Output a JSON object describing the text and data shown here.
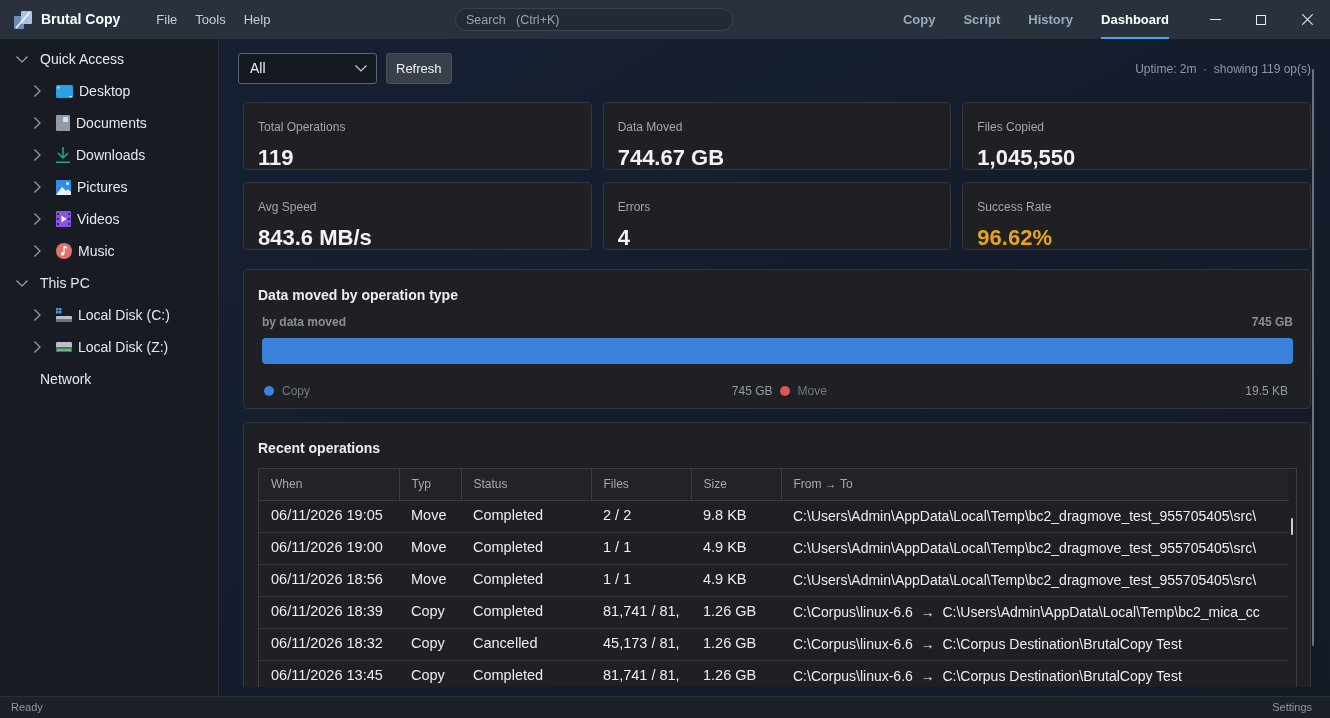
{
  "app": {
    "name": "Brutal Copy"
  },
  "menu": [
    "File",
    "Tools",
    "Help"
  ],
  "search": {
    "placeholder": "Search   (Ctrl+K)"
  },
  "tabs": [
    {
      "label": "Copy",
      "selected": false
    },
    {
      "label": "Script",
      "selected": false
    },
    {
      "label": "History",
      "selected": false
    },
    {
      "label": "Dashboard",
      "selected": true
    }
  ],
  "sidebar": {
    "items": [
      {
        "label": "Quick Access",
        "expanded": true,
        "children": [
          {
            "label": "Desktop",
            "kind": "desktop",
            "expanded": false
          },
          {
            "label": "Documents",
            "kind": "documents",
            "expanded": false
          },
          {
            "label": "Downloads",
            "kind": "downloads",
            "expanded": false
          },
          {
            "label": "Pictures",
            "kind": "pictures",
            "expanded": false
          },
          {
            "label": "Videos",
            "kind": "videos",
            "expanded": false
          },
          {
            "label": "Music",
            "kind": "music",
            "expanded": false
          }
        ]
      },
      {
        "label": "This PC",
        "expanded": true,
        "children": [
          {
            "label": "Local Disk (C:)",
            "kind": "system_drive",
            "expanded": false
          },
          {
            "label": "Local Disk (Z:)",
            "kind": "drive",
            "expanded": false
          }
        ]
      },
      {
        "label": "Network"
      }
    ]
  },
  "toolbar": {
    "filter": {
      "value": "All"
    },
    "refresh_button": "Refresh",
    "uptime": "Uptime: 2m  ·  showing 119 op(s)"
  },
  "stats": [
    {
      "label": "Total Operations",
      "value": "119",
      "color": "#f1f2f4"
    },
    {
      "label": "Data Moved",
      "value": "744.67 GB",
      "color": "#f1f2f4"
    },
    {
      "label": "Files Copied",
      "value": "1,045,550",
      "color": "#f1f2f4"
    },
    {
      "label": "Avg Speed",
      "value": "843.6 MB/s",
      "color": "#f1f2f4"
    },
    {
      "label": "Errors",
      "value": "4",
      "color": "#f1f2f4"
    },
    {
      "label": "Success Rate",
      "value": "96.62%",
      "color": "#e8a317"
    }
  ],
  "breakdown": {
    "title": "Data moved by operation type",
    "subtitle": "by data moved",
    "total": "745 GB",
    "segments": [
      {
        "name": "Copy",
        "color": "#3b82dc",
        "level": 1,
        "reading": "745 GB"
      },
      {
        "name": "Move",
        "color": "#e05555",
        "reading": "19.5 KB"
      }
    ]
  },
  "recent": {
    "title": "Recent operations",
    "table": {
      "columns": [
        "When",
        "Typ",
        "Status",
        "Files",
        "Size",
        "From → To"
      ],
      "rows": [
        [
          "06/11/2026 19:05",
          "Move",
          "Completed",
          "2 / 2",
          "9.8 KB",
          "C:\\Users\\Admin\\AppData\\Local\\Temp\\bc2_dragmove_test_955705405\\src\\"
        ],
        [
          "06/11/2026 19:00",
          "Move",
          "Completed",
          "1 / 1",
          "4.9 KB",
          "C:\\Users\\Admin\\AppData\\Local\\Temp\\bc2_dragmove_test_955705405\\src\\"
        ],
        [
          "06/11/2026 18:56",
          "Move",
          "Completed",
          "1 / 1",
          "4.9 KB",
          "C:\\Users\\Admin\\AppData\\Local\\Temp\\bc2_dragmove_test_955705405\\src\\"
        ],
        [
          "06/11/2026 18:39",
          "Copy",
          "Completed",
          "81,741 / 81,",
          "1.26 GB",
          "C:\\Corpus\\linux-6.6  →  C:\\Users\\Admin\\AppData\\Local\\Temp\\bc2_mica_cc"
        ],
        [
          "06/11/2026 18:32",
          "Copy",
          "Cancelled",
          "45,173 / 81,",
          "1.26 GB",
          "C:\\Corpus\\linux-6.6  →  C:\\Corpus Destination\\BrutalCopy Test"
        ],
        [
          "06/11/2026 13:45",
          "Copy",
          "Completed",
          "81,741 / 81,",
          "1.26 GB",
          "C:\\Corpus\\linux-6.6  →  C:\\Corpus Destination\\BrutalCopy Test"
        ]
      ]
    }
  },
  "status_bar": {
    "text": "Ready",
    "settings": "Settings"
  }
}
